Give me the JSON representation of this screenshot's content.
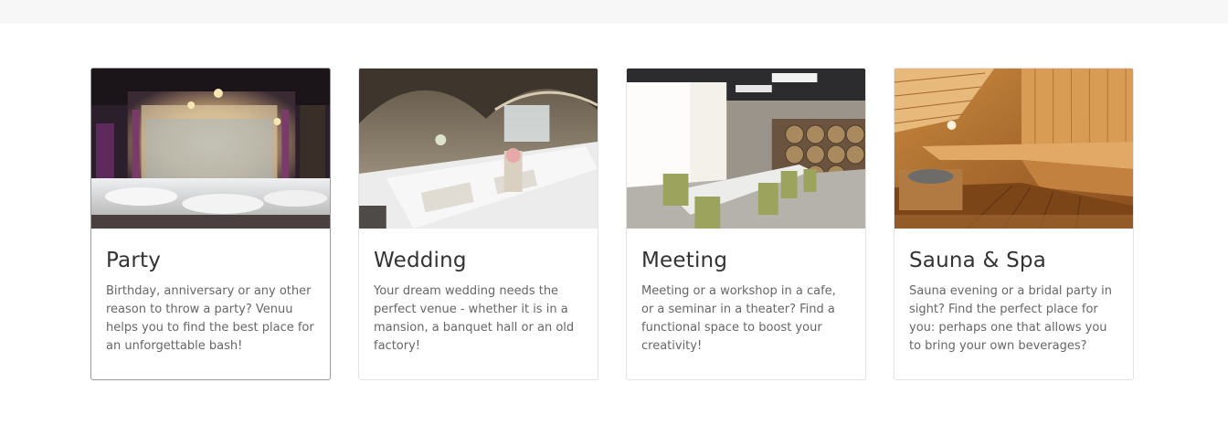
{
  "cards": [
    {
      "title": "Party",
      "description": "Birthday, anniversary or any other reason to throw a party? Venuu helps you to find the best place for an unforgettable bash!",
      "image": "party-venue-theater-photo"
    },
    {
      "title": "Wedding",
      "description": "Your dream wedding needs the perfect venue - whether it is in a mansion, a banquet hall or an old factory!",
      "image": "wedding-banquet-hall-photo"
    },
    {
      "title": "Meeting",
      "description": "Meeting or a workshop in a cafe, or a seminar in a theater? Find a functional space to boost your creativity!",
      "image": "meeting-room-barrels-photo"
    },
    {
      "title": "Sauna & Spa",
      "description": "Sauna evening or a bridal party in sight? Find the perfect place for you: perhaps one that allows you to bring your own beverages?",
      "image": "sauna-wooden-benches-photo"
    }
  ]
}
